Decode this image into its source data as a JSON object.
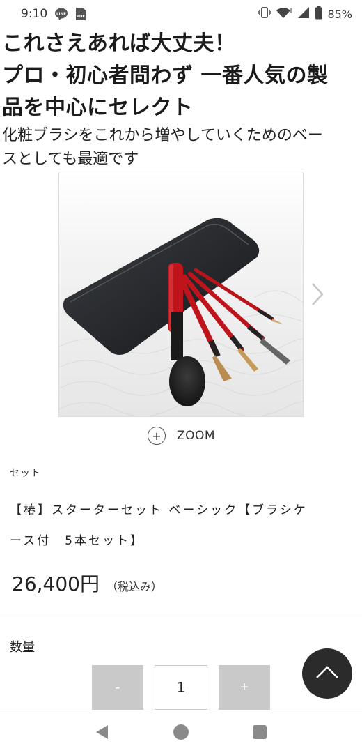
{
  "status_bar": {
    "time": "9:10",
    "notification_icons": [
      "line-icon",
      "pdf-icon"
    ],
    "system_icons": [
      "vibrate-icon",
      "wifi-icon",
      "signal-icon",
      "battery-icon"
    ],
    "battery_percent": "85%"
  },
  "headline": {
    "line1": "これさえあれば大丈夫！",
    "line2": "プロ・初心者問わず 一番人気の製",
    "line3": "品を中心にセレクト"
  },
  "subline": {
    "line1": "化粧ブラシをこれから増やしていくためのベー",
    "line2": "スとしても最適です"
  },
  "gallery": {
    "next_icon": "chevron-right-icon"
  },
  "zoom": {
    "icon": "plus-circle-icon",
    "symbol": "+",
    "label": "ZOOM"
  },
  "product": {
    "category": "セット",
    "name_line1": "【椿】スターターセット ベーシック【ブラシケ",
    "name_line2": "ース付　5本セット】",
    "price": "26,400円",
    "tax_note": "（税込み）"
  },
  "quantity": {
    "label": "数量",
    "minus_label": "-",
    "value": "1",
    "plus_label": "+"
  },
  "scroll_top": {
    "icon": "chevron-up-icon"
  },
  "nav_bar": {
    "back_icon": "back-triangle-icon",
    "home_icon": "home-circle-icon",
    "recents_icon": "recents-square-icon"
  },
  "colors": {
    "text": "#1b1b1b",
    "qty_button": "#c9c9c9",
    "scroll_top_bg": "#2b2b2b",
    "brush_handle_red": "#c0141c",
    "case_black": "#222222"
  }
}
